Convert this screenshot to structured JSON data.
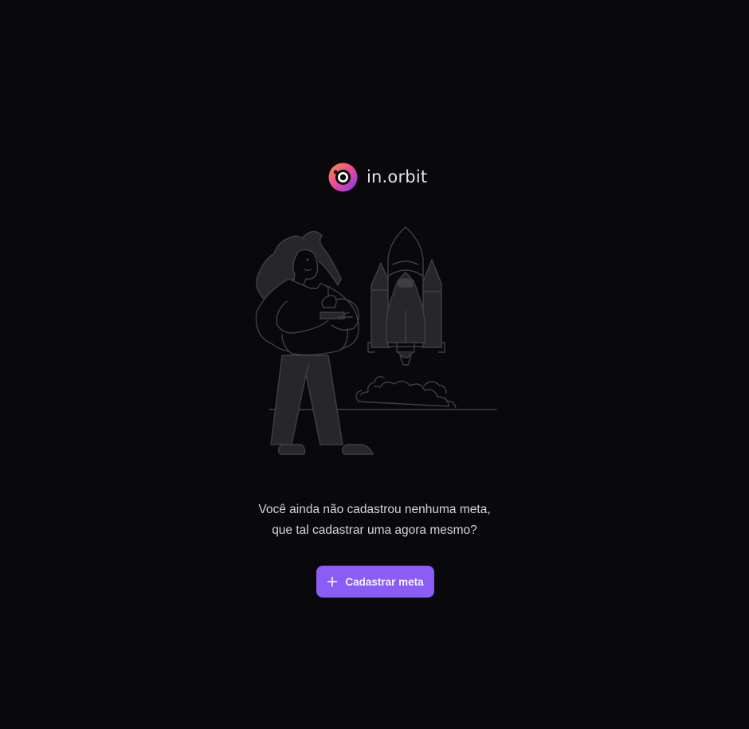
{
  "brand": {
    "name": "in.orbit",
    "logo_icon": "orbit-ring-icon",
    "logo_gradient": [
      "#f97316",
      "#ec4899",
      "#8b5cf6"
    ]
  },
  "empty_state": {
    "illustration_icon": "woman-launching-rocket-illustration",
    "message_line_1": "Você ainda não cadastrou nenhuma meta,",
    "message_line_2": "que tal cadastrar uma agora mesmo?"
  },
  "actions": {
    "create_goal_label": "Cadastrar meta",
    "create_goal_icon": "plus-icon",
    "accent_color": "#8b5cf6"
  }
}
